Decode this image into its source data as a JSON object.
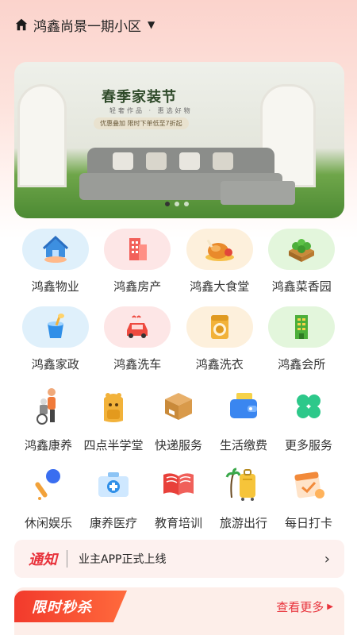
{
  "header": {
    "community": "鸿鑫尚景一期小区",
    "home_icon": "home-icon",
    "caret_icon": "caret-down-icon"
  },
  "banner": {
    "heading": "春季家装节",
    "subtitle": "轻奢作品 · 惠选好物",
    "promo": "优惠叠加 限时下单低至7折起",
    "active_slide": 1,
    "slide_count": 3
  },
  "services_primary": [
    {
      "label": "鸿鑫物业",
      "icon": "property-house-icon",
      "bg": "#dff0fb"
    },
    {
      "label": "鸿鑫房产",
      "icon": "building-icon",
      "bg": "#fde6e6"
    },
    {
      "label": "鸿鑫大食堂",
      "icon": "roast-chicken-icon",
      "bg": "#fdf0dc"
    },
    {
      "label": "鸿鑫菜香园",
      "icon": "vegetable-garden-icon",
      "bg": "#e3f6dc"
    },
    {
      "label": "鸿鑫家政",
      "icon": "cleaning-bucket-icon",
      "bg": "#dff0fb"
    },
    {
      "label": "鸿鑫洗车",
      "icon": "car-wash-icon",
      "bg": "#fde6e6"
    },
    {
      "label": "鸿鑫洗衣",
      "icon": "washing-machine-icon",
      "bg": "#fdf0dc"
    },
    {
      "label": "鸿鑫会所",
      "icon": "clubhouse-building-icon",
      "bg": "#e3f6dc"
    }
  ],
  "services_secondary": [
    {
      "label": "鸿鑫康养",
      "icon": "elderly-care-icon"
    },
    {
      "label": "四点半学堂",
      "icon": "school-backpack-icon"
    },
    {
      "label": "快递服务",
      "icon": "parcel-box-icon"
    },
    {
      "label": "生活缴费",
      "icon": "wallet-icon"
    },
    {
      "label": "更多服务",
      "icon": "clover-more-icon"
    },
    {
      "label": "休闲娱乐",
      "icon": "microphone-icon"
    },
    {
      "label": "康养医疗",
      "icon": "medical-kit-icon"
    },
    {
      "label": "教育培训",
      "icon": "open-book-icon"
    },
    {
      "label": "旅游出行",
      "icon": "suitcase-travel-icon"
    },
    {
      "label": "每日打卡",
      "icon": "checkin-calendar-icon"
    }
  ],
  "notice": {
    "tag": "通知",
    "text": "业主APP正式上线",
    "arrow_icon": "chevron-right-icon"
  },
  "flash_sale": {
    "title": "限时秒杀",
    "more": "查看更多"
  },
  "colors": {
    "accent_red": "#e8323b",
    "header_bg": "#fbd3cc"
  }
}
